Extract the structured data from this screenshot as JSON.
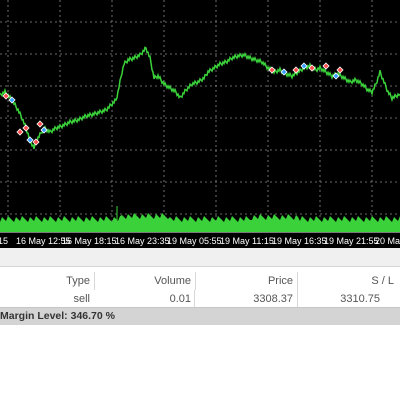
{
  "chart": {
    "background": "#000000",
    "grid_color": "#8c8c8c",
    "price_line_color": "#3ad13a",
    "volume_color": "#3ad13a",
    "time_labels": [
      "15",
      "16 May 12:55",
      "16 May 18:15",
      "16 May 23:35",
      "19 May 05:55",
      "19 May 11:15",
      "19 May 16:35",
      "19 May 21:55",
      "20 May"
    ],
    "trade_markers_color_sell": "#ff4d4d",
    "trade_markers_color_buy": "#3aa0ff"
  },
  "trade_table": {
    "columns": [
      "Type",
      "Volume",
      "Price",
      "S / L"
    ],
    "rows": [
      {
        "type": "sell",
        "volume": "0.01",
        "price": "3308.37",
        "sl": "3310.75"
      }
    ]
  },
  "summary": {
    "margin_level": "Margin Level: 346.70 %"
  }
}
